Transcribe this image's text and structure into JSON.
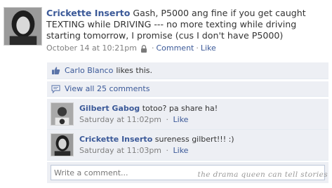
{
  "post": {
    "author": "Crickette Inserto",
    "text": "Gash, P5000 ang fine if you get caught TEXTING while DRIVING --- no more texting while driving starting tomorrow, I promise (cus I don't have P5000)",
    "timestamp": "October 14 at 10:21pm",
    "comment_label": "Comment",
    "like_label": "Like",
    "separator": "·",
    "privacy_icon": "lock-icon"
  },
  "likes": {
    "icon": "thumbs-up-icon",
    "name": "Carlo Blanco",
    "suffix": "likes this."
  },
  "view_all": {
    "icon": "comment-bubble-icon",
    "label": "View all 25 comments"
  },
  "comments": [
    {
      "author": "Gilbert Gabog",
      "text": "totoo? pa share ha!",
      "timestamp": "Saturday at 11:02pm",
      "like_label": "Like",
      "separator": "·"
    },
    {
      "author": "Crickette Inserto",
      "text": "sureness gilbert!!! :)",
      "timestamp": "Saturday at 11:03pm",
      "like_label": "Like",
      "separator": "·"
    }
  ],
  "composer": {
    "placeholder": "Write a comment..."
  },
  "watermark": "the drama queen can tell stories",
  "colors": {
    "link": "#3b5998",
    "feedback_bg": "#edeff4",
    "meta_text": "#808080",
    "input_border": "#bdc7d8"
  }
}
